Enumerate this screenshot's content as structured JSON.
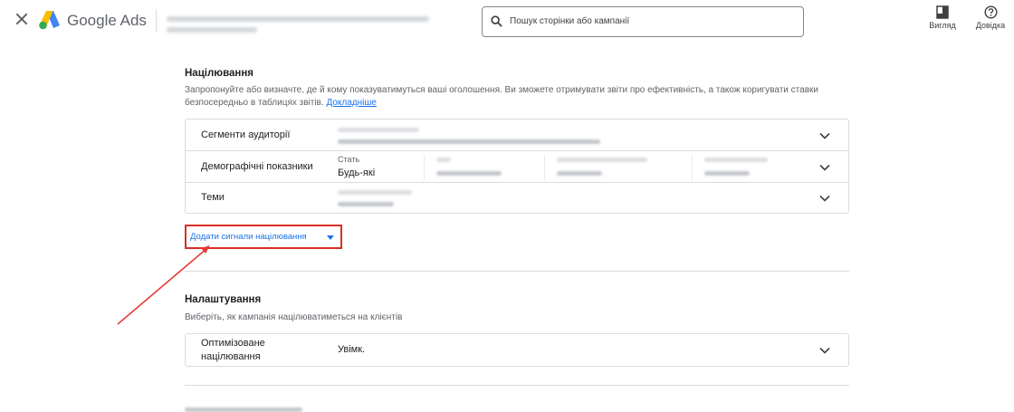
{
  "header": {
    "brand": "Google Ads",
    "search_placeholder": "Пошук сторінки або кампанії",
    "view_label": "Вигляд",
    "help_label": "Довідка"
  },
  "targeting": {
    "title": "Націлювання",
    "description": "Запропонуйте або визначте, де й кому показуватимуться ваші оголошення. Ви зможете отримувати звіти про ефективність, а також коригувати ставки безпосередньо в таблицях звітів.",
    "learn_more": "Докладніше",
    "rows": {
      "audience": {
        "label": "Сегменти аудиторії"
      },
      "demographics": {
        "label": "Демографічні показники",
        "gender_title": "Стать",
        "gender_value": "Будь-які"
      },
      "topics": {
        "label": "Теми"
      }
    },
    "add_signals": "Додати сигнали націлювання"
  },
  "settings": {
    "title": "Налаштування",
    "description": "Виберіть, як кампанія націлюватиметься на клієнтів",
    "optimized_label": "Оптимізоване націлювання",
    "optimized_value": "Увімк."
  },
  "colors": {
    "accent": "#1a73e8",
    "highlight": "#d93025",
    "border": "#dadce0"
  }
}
